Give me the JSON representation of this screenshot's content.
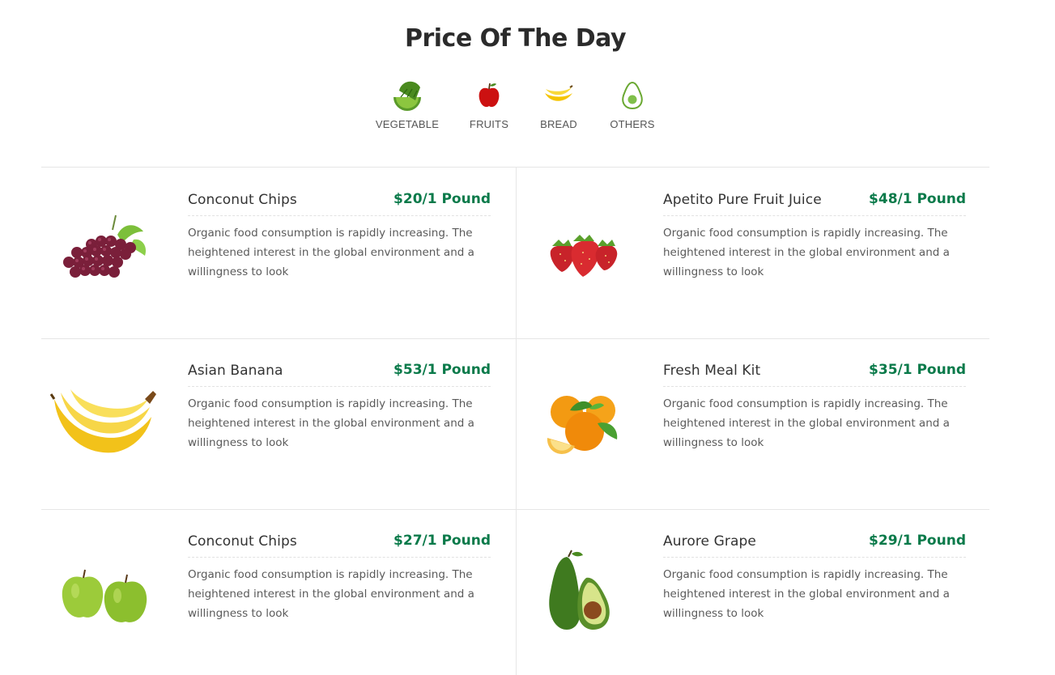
{
  "section": {
    "title": "Price Of The Day"
  },
  "categories": [
    {
      "label": "VEGETABLE",
      "icon": "watermelon-icon"
    },
    {
      "label": "FRUITS",
      "icon": "apple-icon"
    },
    {
      "label": "BREAD",
      "icon": "banana-icon"
    },
    {
      "label": "OTHERS",
      "icon": "avocado-icon"
    }
  ],
  "items": [
    {
      "name": "Conconut Chips",
      "price": "$20/1 Pound",
      "image": "grapes-image",
      "desc": [
        "Organic food consumption is rapidly increasing. The",
        "heightened interest in the global environment and a",
        "willingness to look"
      ]
    },
    {
      "name": "Apetito Pure Fruit Juice",
      "price": "$48/1 Pound",
      "image": "strawberries-image",
      "desc": [
        "Organic food consumption is rapidly increasing. The",
        "heightened interest in the global environment and a",
        "willingness to look"
      ]
    },
    {
      "name": "Asian Banana",
      "price": "$53/1 Pound",
      "image": "bananas-image",
      "desc": [
        "Organic food consumption is rapidly increasing. The",
        "heightened interest in the global environment and a",
        "willingness to look"
      ]
    },
    {
      "name": "Fresh Meal Kit",
      "price": "$35/1 Pound",
      "image": "oranges-image",
      "desc": [
        "Organic food consumption is rapidly increasing. The",
        "heightened interest in the global environment and a",
        "willingness to look"
      ]
    },
    {
      "name": "Conconut Chips",
      "price": "$27/1 Pound",
      "image": "green-apples-image",
      "desc": [
        "Organic food consumption is rapidly increasing. The",
        "heightened interest in the global environment and a",
        "willingness to look"
      ]
    },
    {
      "name": "Aurore Grape",
      "price": "$29/1 Pound",
      "image": "avocado-image",
      "desc": [
        "Organic food consumption is rapidly increasing. The",
        "heightened interest in the global environment and a",
        "willingness to look"
      ]
    }
  ],
  "colors": {
    "price": "#0a7a4a",
    "title": "#2b2b2b",
    "divider": "#e6e6e6"
  }
}
